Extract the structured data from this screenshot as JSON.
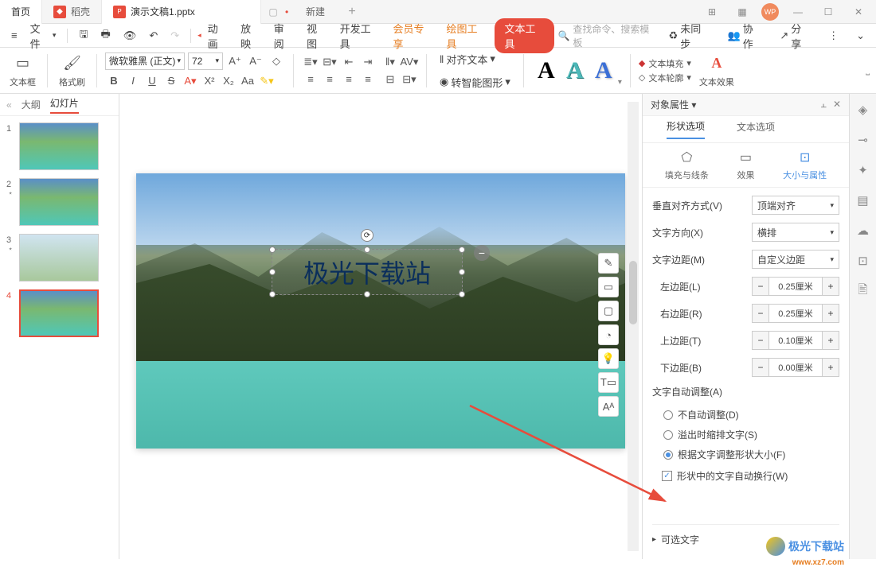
{
  "titlebar": {
    "home": "首页",
    "docker": "稻壳",
    "doc": "演示文稿1.pptx",
    "new": "新建"
  },
  "menubar": {
    "file": "文件",
    "items": [
      "动画",
      "放映",
      "审阅",
      "视图",
      "开发工具",
      "会员专享"
    ],
    "drawing": "绘图工具",
    "texttool": "文本工具",
    "search_placeholder": "查找命令、搜索模板",
    "unsync": "未同步",
    "collab": "协作",
    "share": "分享"
  },
  "toolbar": {
    "textbox": "文本框",
    "format_painter": "格式刷",
    "font_name": "微软雅黑 (正文)",
    "font_size": "72",
    "align_text": "对齐文本",
    "smart_graphic": "转智能图形",
    "text_fill": "文本填充",
    "text_outline": "文本轮廓",
    "text_effects": "文本效果"
  },
  "slidetabs": {
    "outline": "大纲",
    "slides": "幻灯片"
  },
  "canvas": {
    "text": "极光下载站"
  },
  "panel": {
    "title": "对象属性",
    "tab_shape": "形状选项",
    "tab_text": "文本选项",
    "sub_fill": "填充与线条",
    "sub_effect": "效果",
    "sub_size": "大小与属性",
    "valign_label": "垂直对齐方式(V)",
    "valign_value": "顶端对齐",
    "textdir_label": "文字方向(X)",
    "textdir_value": "横排",
    "margin_label": "文字边距(M)",
    "margin_value": "自定义边距",
    "left_margin": "左边距(L)",
    "left_margin_val": "0.25厘米",
    "right_margin": "右边距(R)",
    "right_margin_val": "0.25厘米",
    "top_margin": "上边距(T)",
    "top_margin_val": "0.10厘米",
    "bottom_margin": "下边距(B)",
    "bottom_margin_val": "0.00厘米",
    "autofit_title": "文字自动调整(A)",
    "autofit_none": "不自动调整(D)",
    "autofit_shrink": "溢出时缩排文字(S)",
    "autofit_resize": "根据文字调整形状大小(F)",
    "wrap": "形状中的文字自动换行(W)",
    "optional_text": "可选文字"
  },
  "watermark": {
    "text": "极光下载站",
    "url": "www.xz7.com"
  }
}
